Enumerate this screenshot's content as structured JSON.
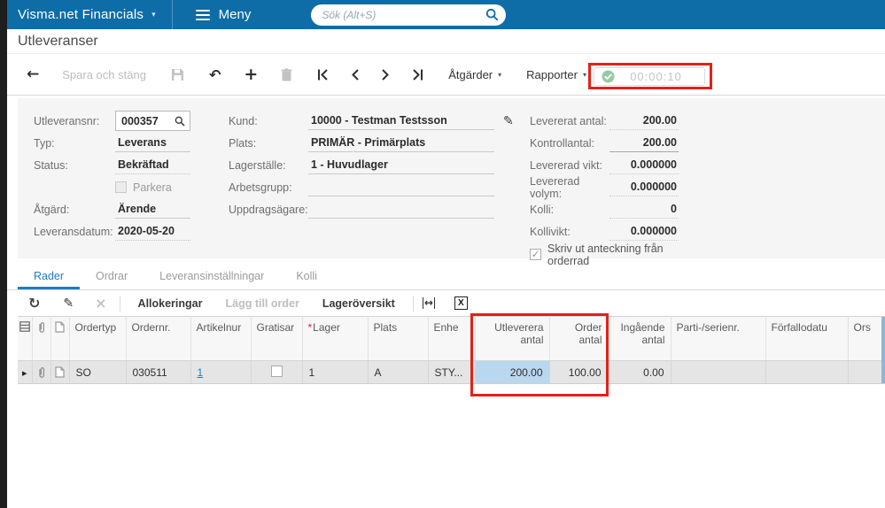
{
  "topbar": {
    "brand": "Visma.net Financials",
    "menu_label": "Meny",
    "search_placeholder": "Sök (Alt+S)"
  },
  "page_title": "Utleveranser",
  "toolbar": {
    "save_and_close": "Spara och stäng",
    "actions_label": "Åtgärder",
    "reports_label": "Rapporter",
    "timer_value": "00:00:10"
  },
  "form": {
    "utleveransnr_label": "Utleveransnr:",
    "utleveransnr_value": "000357",
    "typ_label": "Typ:",
    "typ_value": "Leverans",
    "status_label": "Status:",
    "status_value": "Bekräftad",
    "parkera_label": "Parkera",
    "atgard_label": "Åtgärd:",
    "atgard_value": "Ärende",
    "leveransdatum_label": "Leveransdatum:",
    "leveransdatum_value": "2020-05-20",
    "kund_label": "Kund:",
    "kund_value": "10000 - Testman Testsson",
    "plats_label": "Plats:",
    "plats_value": "PRIMÄR - Primärplats",
    "lagerstalle_label": "Lagerställe:",
    "lagerstalle_value": "1 - Huvudlager",
    "arbetsgrupp_label": "Arbetsgrupp:",
    "arbetsgrupp_value": "",
    "uppdragsagare_label": "Uppdragsägare:",
    "uppdragsagare_value": "",
    "levererat_antal_label": "Levererat antal:",
    "levererat_antal_value": "200.00",
    "kontrollantal_label": "Kontrollantal:",
    "kontrollantal_value": "200.00",
    "levererad_vikt_label": "Levererad vikt:",
    "levererad_vikt_value": "0.000000",
    "levererad_volym_label": "Levererad volym:",
    "levererad_volym_value": "0.000000",
    "kolli_label": "Kolli:",
    "kolli_value": "0",
    "kollivikt_label": "Kollivikt:",
    "kollivikt_value": "0.000000",
    "skriv_ut_anteckning_label": "Skriv ut anteckning från orderrad"
  },
  "tabs": {
    "items": [
      {
        "label": "Rader",
        "active": true
      },
      {
        "label": "Ordrar",
        "active": false
      },
      {
        "label": "Leveransinställningar",
        "active": false
      },
      {
        "label": "Kolli",
        "active": false
      }
    ]
  },
  "grid_toolbar": {
    "allokeringar_label": "Allokeringar",
    "lagg_till_order_label": "Lägg till order",
    "lageroversikt_label": "Lageröversikt"
  },
  "grid": {
    "headers": {
      "ordertyp": "Ordertyp",
      "ordernr": "Ordernr.",
      "artikelnr": "Artikelnur",
      "gratisar": "Gratisar",
      "lager_required_mark": "*",
      "lager": "Lager",
      "plats": "Plats",
      "enhet": "Enhe",
      "utlevererat_line1": "Utleverera",
      "utlevererat_line2": "antal",
      "order_line1": "Order",
      "order_line2": "antal",
      "ingaende_line1": "Ingående",
      "ingaende_line2": "antal",
      "parti_serienr": "Parti-/serienr.",
      "forfallodatum": "Förfallodatu",
      "orsak": "Ors"
    },
    "row": {
      "ordertyp": "SO",
      "ordernr": "030511",
      "artikelnr": "1",
      "lager": "1",
      "plats": "A",
      "enhet": "STY...",
      "utlevererat_antal": "200.00",
      "order_antal": "100.00",
      "ingaende_antal": "0.00"
    }
  },
  "icons": {
    "dropdown_caret": "▾",
    "back_glyph": "←",
    "undo_glyph": "↶",
    "add_glyph": "+",
    "refresh_glyph": "↻",
    "edit_glyph": "✎",
    "close_glyph": "×",
    "fit_glyph": "↔",
    "excel_glyph": "X",
    "expander_glyph": "▸",
    "check_glyph": "✓",
    "pencil_glyph": "✎"
  },
  "colors": {
    "topbar_blue": "#0e6da6",
    "link_blue": "#1d7dc2",
    "annotation_red": "#e32119",
    "selected_cell_blue": "#b9d7ee",
    "timer_check_green": "#93cba1"
  }
}
